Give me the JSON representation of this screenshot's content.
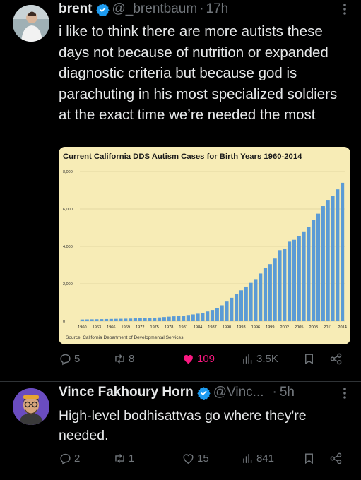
{
  "tweet1": {
    "author_name": "brent",
    "handle": "@_brentbaum",
    "separator": "·",
    "time": "17h",
    "text": "i like to think there are more autists these days not because of nutrition or expanded diagnostic criteria but because god is parachuting in his most specialized soldiers at the exact time we’re needed the most",
    "actions": {
      "replies": "5",
      "reposts": "8",
      "likes": "109",
      "views": "3.5K"
    }
  },
  "tweet2": {
    "author_name": "Vince Fakhoury Horn",
    "handle": "@Vinc...",
    "separator": "·",
    "time": "5h",
    "text": "High-level bodhisattvas go where they're needed.",
    "actions": {
      "replies": "2",
      "reposts": "1",
      "likes": "15",
      "views": "841"
    }
  },
  "colors": {
    "background": "#000000",
    "text": "#e7e9ea",
    "muted": "#71767b",
    "verified": "#1d9bf0",
    "like": "#f91880",
    "chart_bg": "#f7ecb6",
    "bar": "#5b9bd5"
  },
  "icons": [
    "verified-badge-icon",
    "more-icon",
    "reply-icon",
    "repost-icon",
    "like-icon",
    "views-icon",
    "bookmark-icon",
    "share-icon"
  ],
  "chart_data": {
    "type": "bar",
    "title": "Current California DDS Autism Cases for Birth Years 1960-2014",
    "source": "Source: California Department of Developmental Services",
    "x_start": 1960,
    "x_end": 2014,
    "tick_labels": [
      "1960",
      "1963",
      "1966",
      "1969",
      "1972",
      "1975",
      "1978",
      "1981",
      "1984",
      "1987",
      "1990",
      "1993",
      "1996",
      "1999",
      "2002",
      "2005",
      "2008",
      "2011",
      "2014"
    ],
    "y_tick_labels": [
      "0",
      "2,000",
      "4,000",
      "6,000",
      "8,000"
    ],
    "ylim": [
      0,
      8000
    ],
    "grid": true,
    "values": [
      90,
      95,
      100,
      105,
      110,
      115,
      120,
      125,
      130,
      135,
      140,
      150,
      160,
      170,
      180,
      190,
      200,
      220,
      240,
      260,
      280,
      300,
      330,
      360,
      400,
      450,
      520,
      600,
      700,
      850,
      1050,
      1250,
      1450,
      1650,
      1850,
      2050,
      2250,
      2550,
      2850,
      3050,
      3350,
      3800,
      3850,
      4250,
      4350,
      4550,
      4800,
      5050,
      5400,
      5750,
      6150,
      6450,
      6700,
      7050,
      7400
    ]
  }
}
